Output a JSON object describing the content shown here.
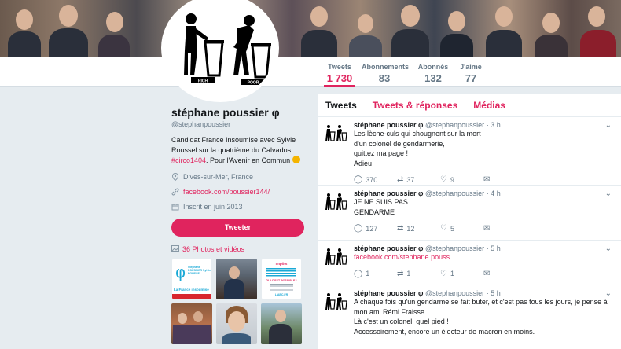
{
  "profile_nav": {
    "tweets_label": "Tweets",
    "tweets_count": "1 730",
    "following_label": "Abonnements",
    "following_count": "83",
    "followers_label": "Abonnés",
    "followers_count": "132",
    "likes_label": "J'aime",
    "likes_count": "77"
  },
  "avatar_text": {
    "left": "RICH",
    "right": "POOR"
  },
  "profile": {
    "name": "stéphane poussier φ",
    "handle": "@stephanpoussier",
    "bio_pre": "Candidat France Insoumise avec Sylvie Roussel sur la quatrième du Calvados ",
    "bio_tag": "#circo1404",
    "bio_post": ". Pour l'Avenir en Commun",
    "location": "Dives-sur-Mer, France",
    "website": "facebook.com/poussier144/",
    "joined": "Inscrit en juin 2013",
    "tweet_button": "Tweeter",
    "media_label": "36 Photos et vidéos"
  },
  "thumbnails": {
    "t1_title": "Stéphane POUSSIER Sylvie ROUSSEL",
    "t1_foot": "La France insoumise",
    "t3_top": "Impôts",
    "t3_mid": "OUI C'EST POSSIBLE !",
    "t3_foot": "L'AEC.FR"
  },
  "tabs": {
    "tweets": "Tweets",
    "replies": "Tweets & réponses",
    "media": "Médias"
  },
  "tweets": [
    {
      "name": "stéphane poussier φ",
      "handle": "@stephanpoussier",
      "time": "· 3 h",
      "lines": [
        "Les lèche-culs qui chougnent sur la mort",
        "d'un colonel de gendarmerie,",
        "quittez ma page !",
        "Adieu"
      ],
      "replies": "370",
      "retweets": "37",
      "likes": "9"
    },
    {
      "name": "stéphane poussier φ",
      "handle": "@stephanpoussier",
      "time": "· 4 h",
      "lines": [
        "JE NE SUIS PAS",
        "GENDARME"
      ],
      "replies": "127",
      "retweets": "12",
      "likes": "5"
    },
    {
      "name": "stéphane poussier φ",
      "handle": "@stephanpoussier",
      "time": "· 5 h",
      "link": "facebook.com/stephane.pouss...",
      "replies": "1",
      "retweets": "1",
      "likes": "1"
    },
    {
      "name": "stéphane poussier φ",
      "handle": "@stephanpoussier",
      "time": "· 5 h",
      "lines": [
        "A chaque fois qu'un gendarme se fait buter, et c'est pas tous les jours, je pense à",
        "mon ami Rémi Fraisse ...",
        "Là c'est un colonel, quel pied !",
        "Accessoirement, encore un électeur de macron en moins."
      ]
    }
  ],
  "colors": {
    "accent": "#e0245e",
    "muted": "#657786",
    "background": "#e6ecf0"
  }
}
